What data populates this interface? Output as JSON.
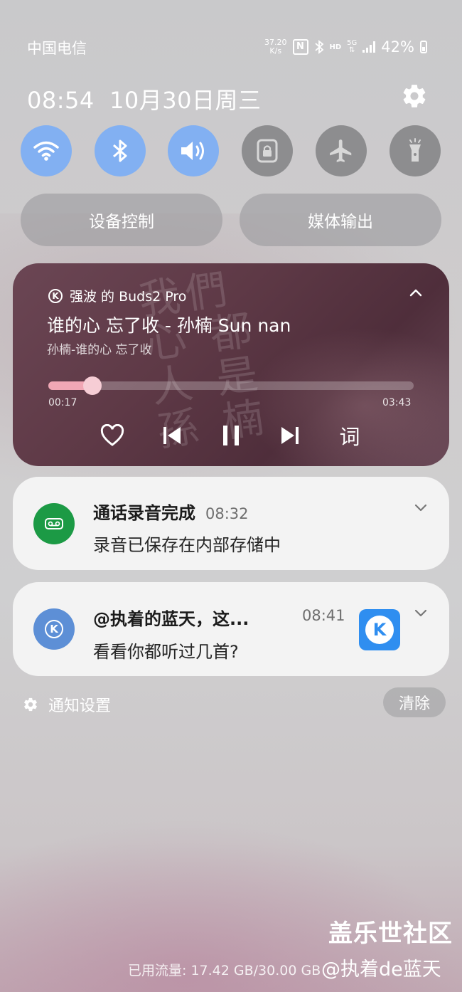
{
  "status_bar": {
    "carrier": "中国电信",
    "net_speed_value": "37.20",
    "net_speed_unit": "K/s",
    "nfc": "N",
    "hd": "HD",
    "network": "5G",
    "battery": "42%"
  },
  "header": {
    "clock": "08:54",
    "date": "10月30日周三"
  },
  "quick_toggles": [
    {
      "name": "wifi",
      "state": "on"
    },
    {
      "name": "bluetooth",
      "state": "on"
    },
    {
      "name": "sound",
      "state": "on"
    },
    {
      "name": "rotation-lock",
      "state": "off"
    },
    {
      "name": "airplane-mode",
      "state": "off"
    },
    {
      "name": "flashlight",
      "state": "off"
    }
  ],
  "panel_buttons": {
    "device_control": "设备控制",
    "media_output": "媒体输出"
  },
  "media": {
    "source_icon": "K",
    "source": "强波 的 Buds2 Pro",
    "title": "谁的心 忘了收 - 孙楠 Sun nan",
    "subtitle": "孙楠-谁的心 忘了收",
    "elapsed": "00:17",
    "duration": "03:43",
    "progress": 0.076,
    "lyrics_label": "词",
    "album_art_text": "我們\n心 都\n人 是\n孫 楠"
  },
  "notifications": [
    {
      "app": "call-recorder",
      "title": "通话录音完成",
      "time": "08:32",
      "body": "录音已保存在内部存储中"
    },
    {
      "app": "kugou",
      "title": "@执着的蓝天，这...",
      "time": "08:41",
      "body": "看看你都听过几首?",
      "thumb": "K",
      "icon": "K"
    }
  ],
  "footer": {
    "notification_settings": "通知设置",
    "clear": "清除",
    "data_usage": "已用流量: 17.42 GB/30.00 GB"
  },
  "watermark": {
    "line1": "盖乐世社区",
    "line2": "@执着de蓝天"
  },
  "colors": {
    "toggle_on": "#82b0f2",
    "toggle_off": "#8d8d8f",
    "recorder_green": "#1c9a45",
    "kugou_blue": "#2f8ef0",
    "progress_pink": "#f1a7b5"
  }
}
